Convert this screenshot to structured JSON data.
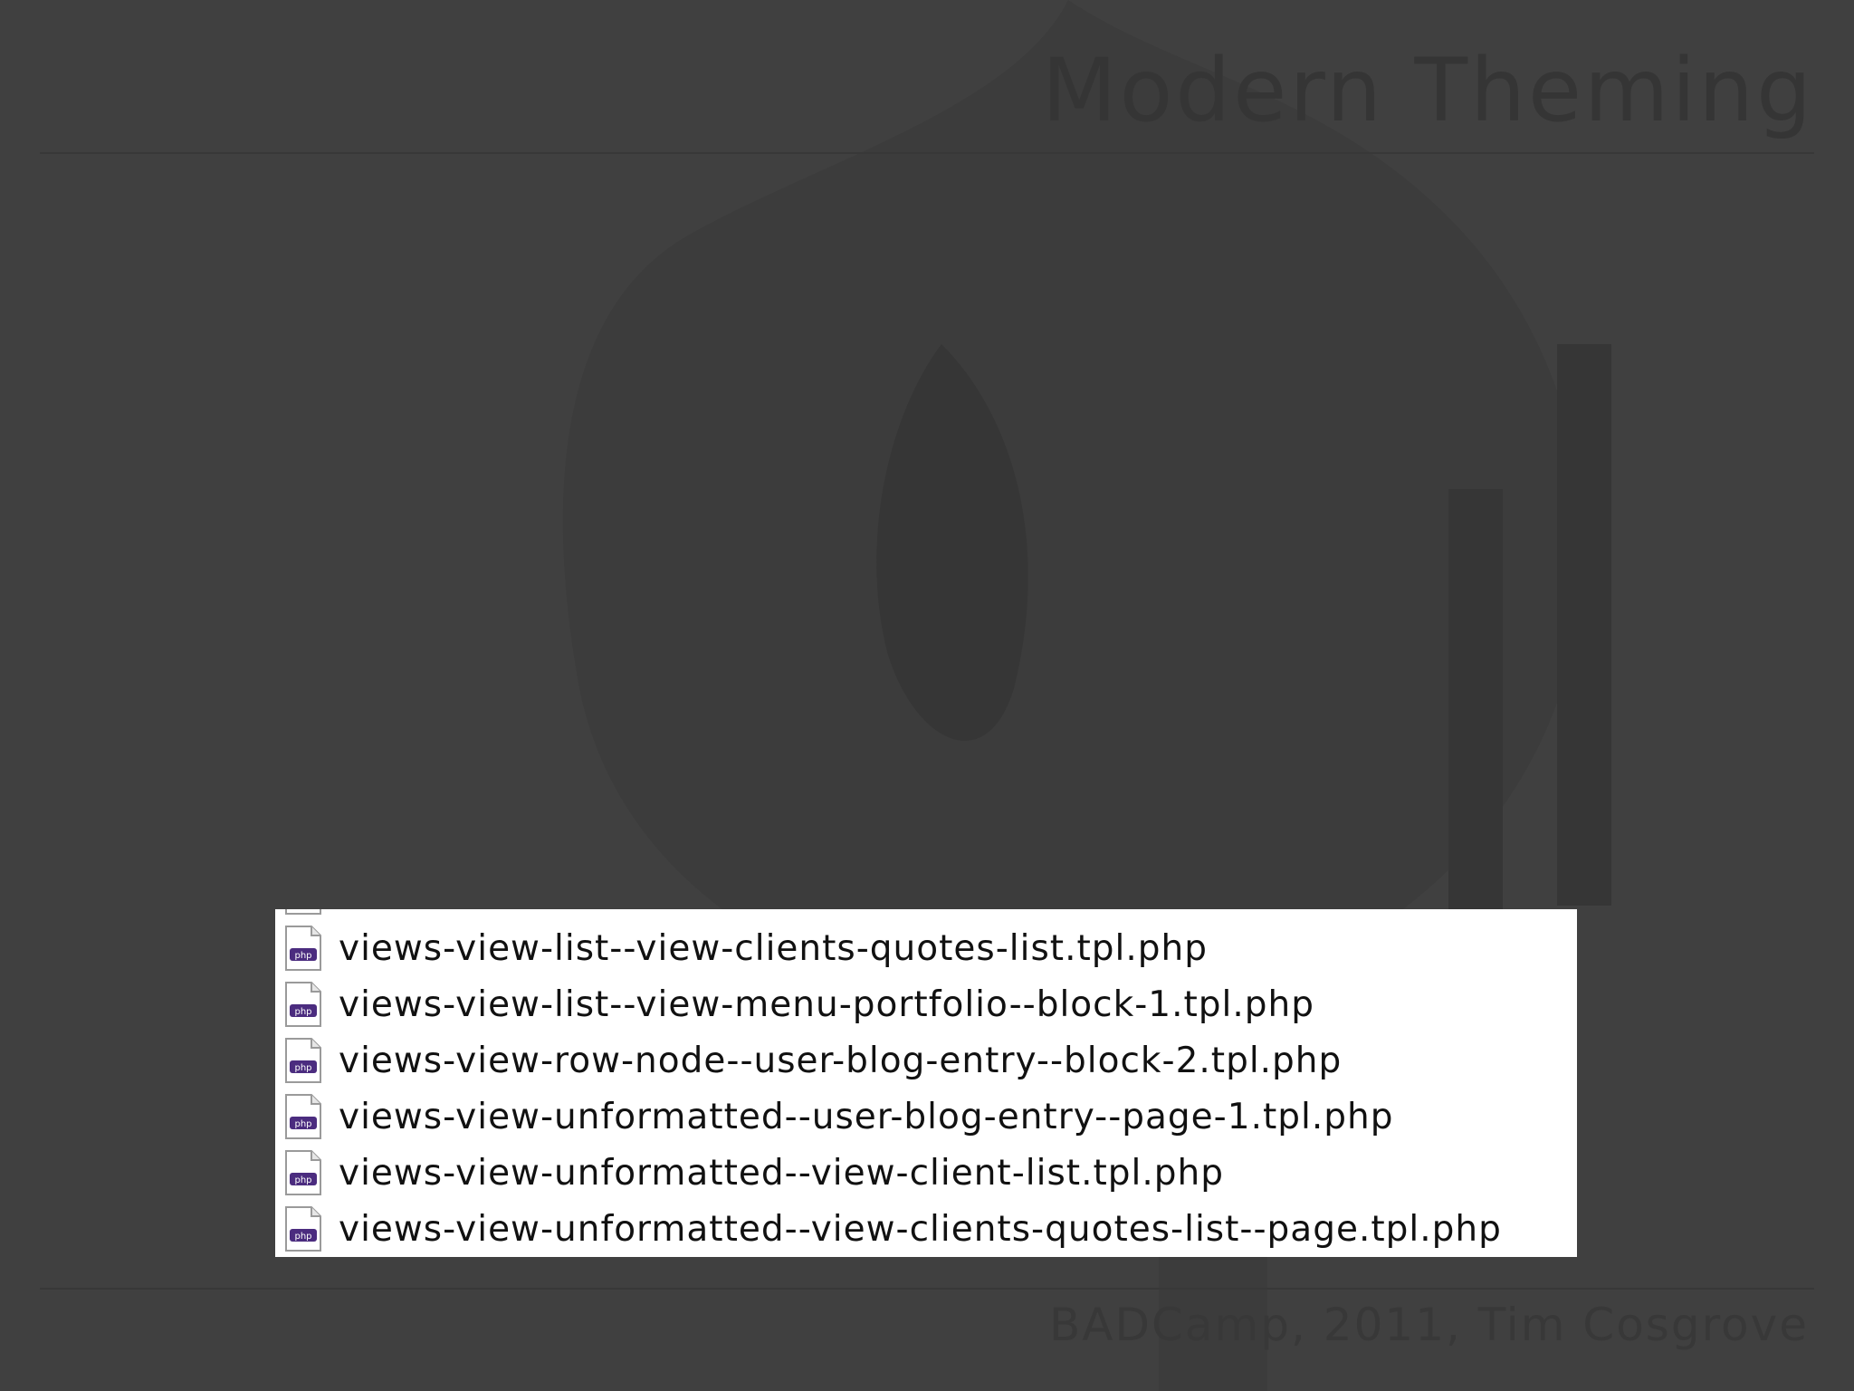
{
  "slide": {
    "title": "Modern Theming",
    "footer": "BADCamp, 2011, Tim Cosgrove"
  },
  "colors": {
    "background": "#404040",
    "title": "#353535",
    "panel": "#ffffff",
    "icon_accent": "#4b2c7f"
  },
  "file_list": {
    "icon": "php-file-icon",
    "files": [
      {
        "name": "views-view-list--view-clients-quotes-list.tpl.php"
      },
      {
        "name": "views-view-list--view-menu-portfolio--block-1.tpl.php"
      },
      {
        "name": "views-view-row-node--user-blog-entry--block-2.tpl.php"
      },
      {
        "name": "views-view-unformatted--user-blog-entry--page-1.tpl.php"
      },
      {
        "name": "views-view-unformatted--view-client-list.tpl.php"
      },
      {
        "name": "views-view-unformatted--view-clients-quotes-list--page.tpl.php"
      }
    ]
  }
}
